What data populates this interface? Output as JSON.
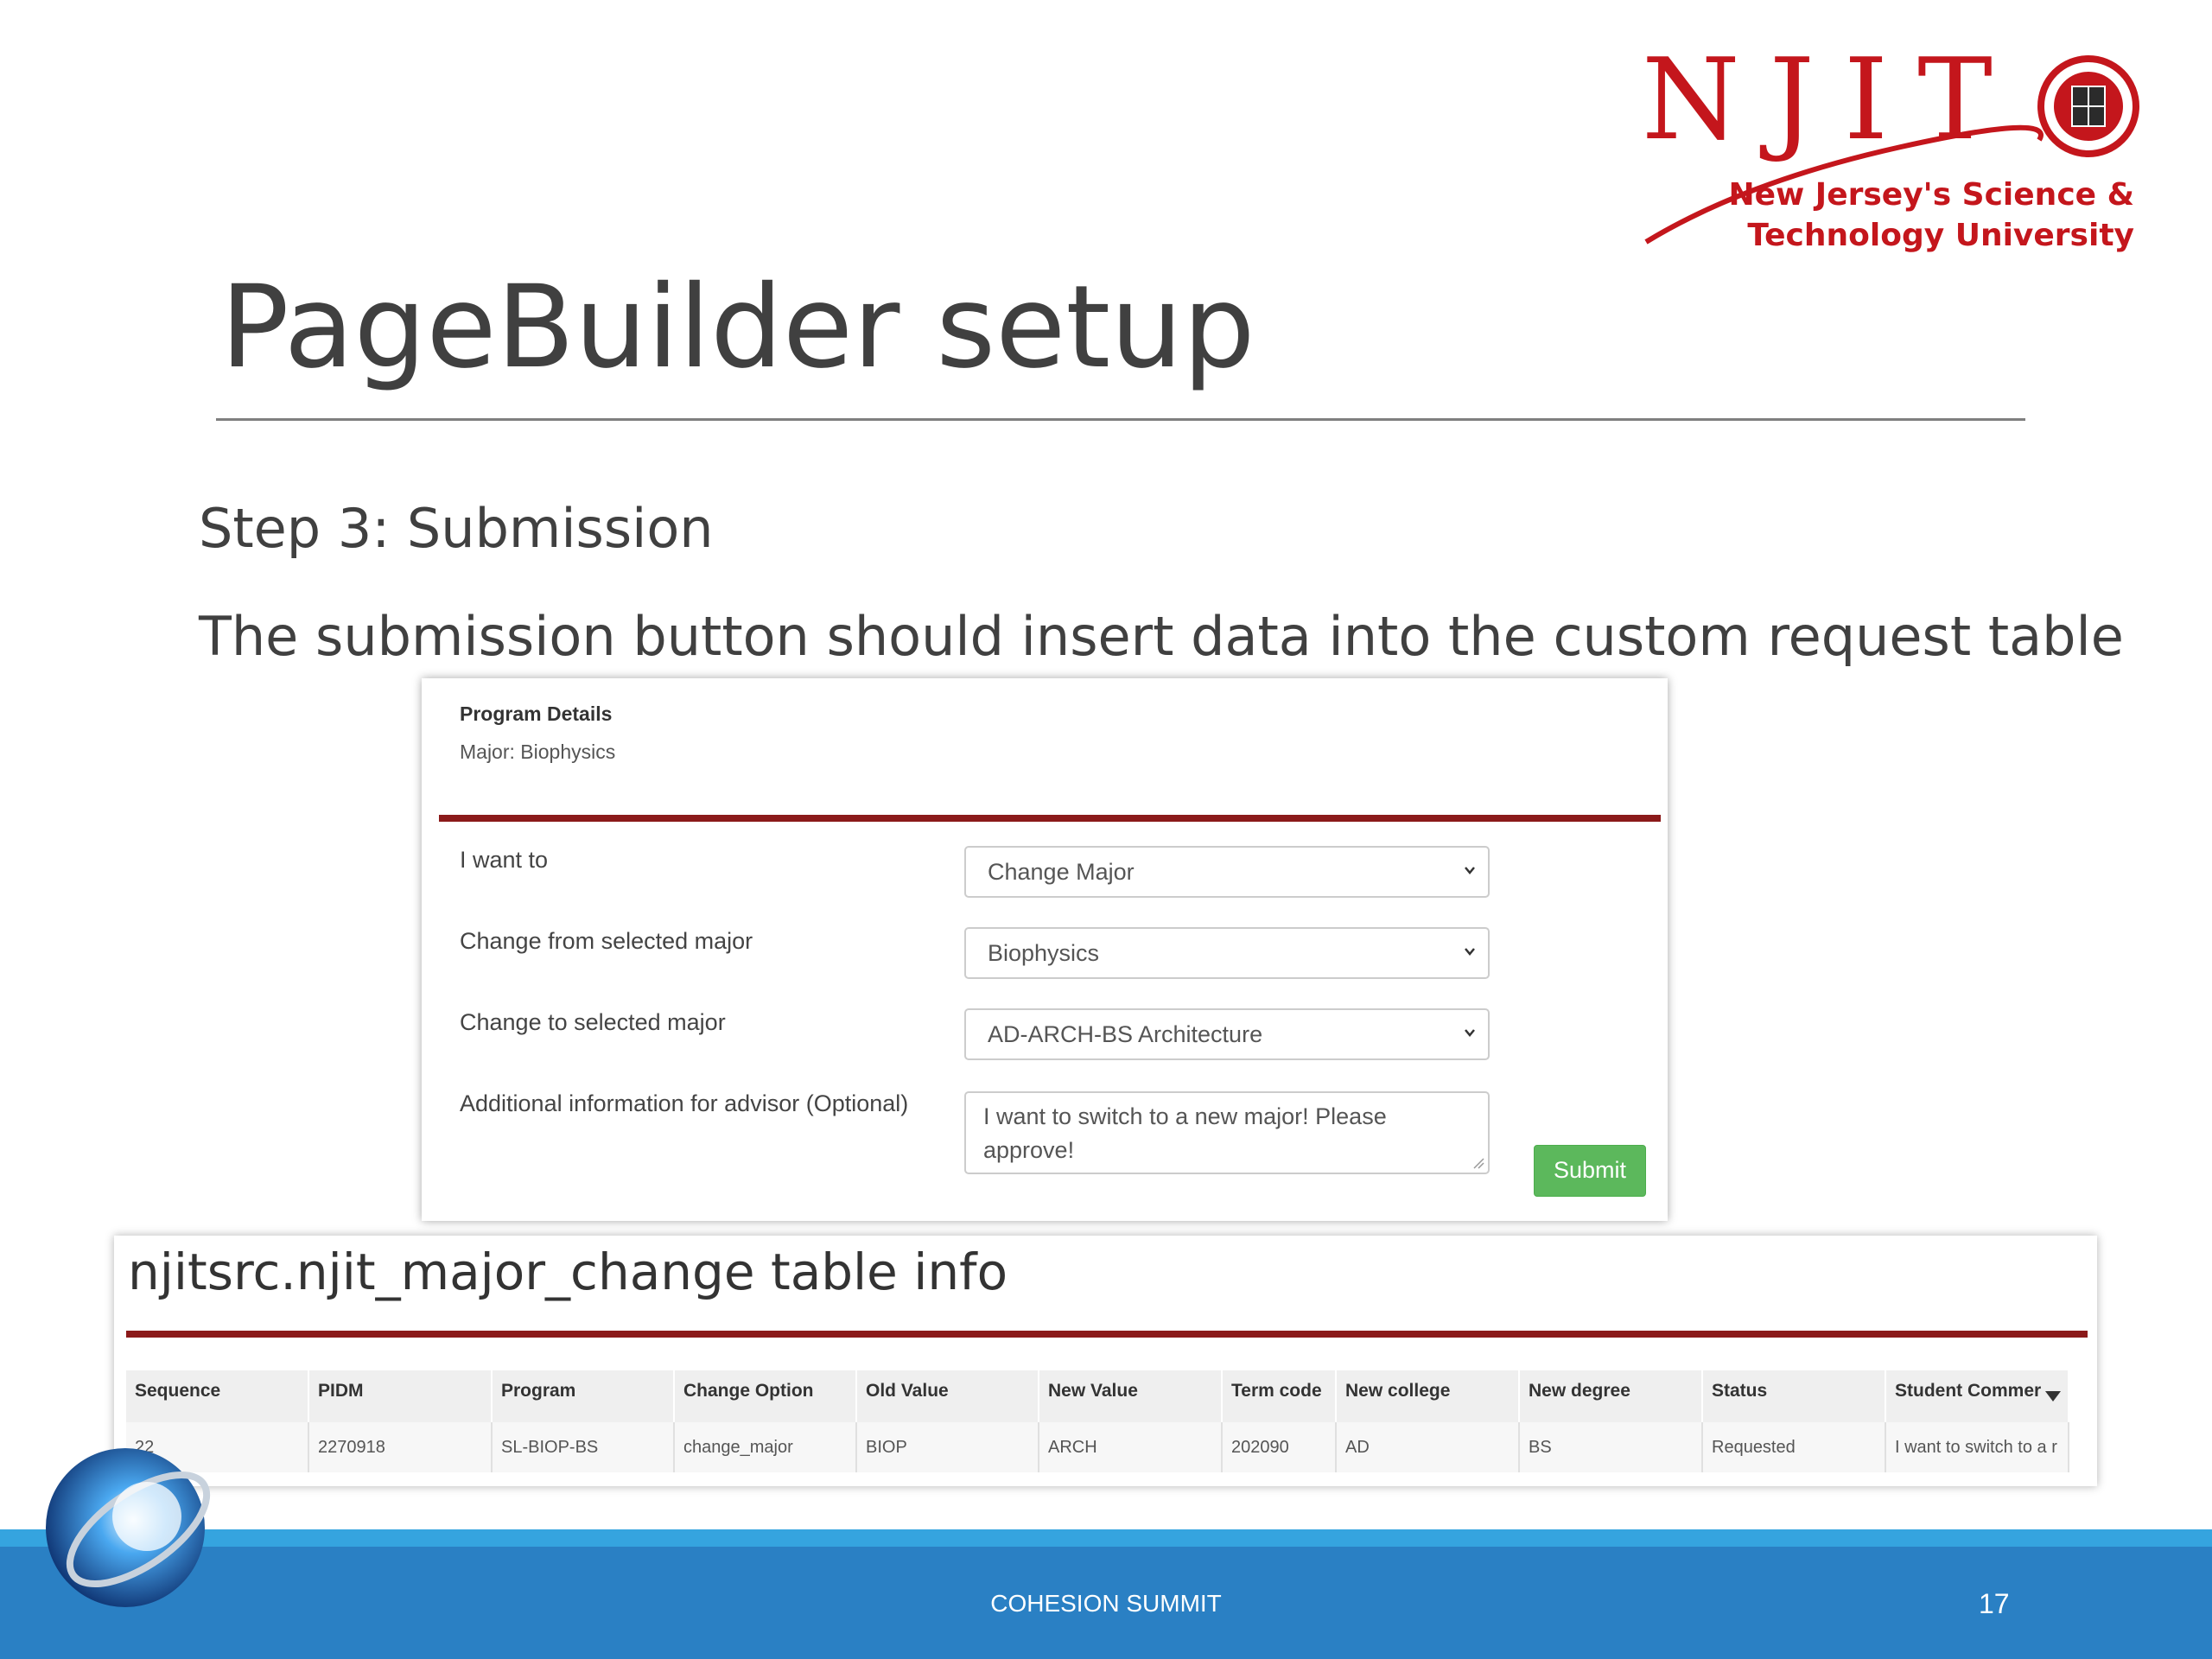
{
  "logo": {
    "wordmark": "NJIT",
    "tagline_line1": "New Jersey's Science &",
    "tagline_line2": "Technology University",
    "brand_color": "#c4161c"
  },
  "slide": {
    "title": "PageBuilder setup",
    "step": "Step 3: Submission",
    "description": "The submission button should insert data into the custom request table"
  },
  "form": {
    "section_heading": "Program Details",
    "major_line": "Major: Biophysics",
    "fields": [
      {
        "label": "I want to",
        "value": "Change Major"
      },
      {
        "label": "Change from selected major",
        "value": "Biophysics"
      },
      {
        "label": "Change to selected major",
        "value": "AD-ARCH-BS Architecture"
      }
    ],
    "notes_label": "Additional information for advisor (Optional)",
    "notes_value": "I want to switch to a new major! Please approve!",
    "submit_label": "Submit",
    "accent_color": "#8b1a1a",
    "submit_color": "#5cb85c"
  },
  "table": {
    "title": "njitsrc.njit_major_change table info",
    "columns": [
      "Sequence",
      "PIDM",
      "Program",
      "Change Option",
      "Old Value",
      "New Value",
      "Term code",
      "New college",
      "New degree",
      "Status",
      "Student Commer"
    ],
    "rows": [
      [
        "22",
        "2270918",
        "SL-BIOP-BS",
        "change_major",
        "BIOP",
        "ARCH",
        "202090",
        "AD",
        "BS",
        "Requested",
        "I want to switch to a r"
      ]
    ]
  },
  "footer": {
    "text": "COHESION SUMMIT",
    "page_number": "17",
    "bar_color": "#2a80c4"
  }
}
